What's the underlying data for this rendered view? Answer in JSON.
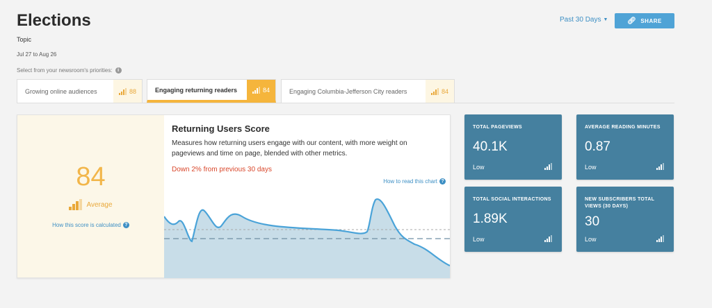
{
  "header": {
    "title": "Elections",
    "topic": "Topic",
    "date_range": "Jul 27 to Aug 26",
    "priorities_prompt": "Select from your newsroom's priorities:",
    "period": "Past 30 Days",
    "share_label": "SHARE"
  },
  "tabs": [
    {
      "label": "Growing online audiences",
      "score": "88"
    },
    {
      "label": "Engaging returning readers",
      "score": "84"
    },
    {
      "label": "Engaging Columbia-Jefferson City readers",
      "score": "84"
    }
  ],
  "score_card": {
    "score": "84",
    "rating": "Average",
    "calc_link": "How this score is calculated",
    "title": "Returning Users Score",
    "description": "Measures how returning users engage with our content, with more weight on pageviews and time on page, blended with other metrics.",
    "trend": "Down 2% from previous 30 days",
    "read_link": "How to read this chart"
  },
  "metrics": [
    {
      "label": "TOTAL PAGEVIEWS",
      "value": "40.1K",
      "level": "Low"
    },
    {
      "label": "AVERAGE READING MINUTES",
      "value": "0.87",
      "level": "Low"
    },
    {
      "label": "TOTAL SOCIAL INTERACTIONS",
      "value": "1.89K",
      "level": "Low"
    },
    {
      "label": "NEW SUBSCRIBERS TOTAL VIEWS (30 DAYS)",
      "value": "30",
      "level": "Low"
    }
  ],
  "colors": {
    "accent_blue": "#4fa3d6",
    "score_yellow": "#f5b53c",
    "trend_red": "#d9472b",
    "metric_tile": "#45809f"
  }
}
